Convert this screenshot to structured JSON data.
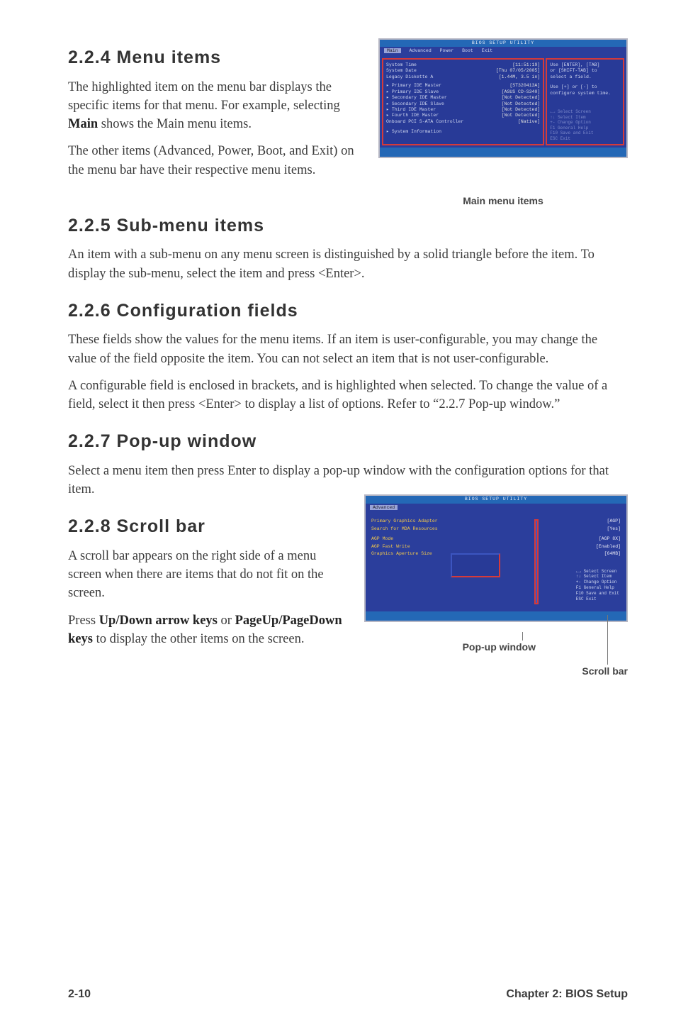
{
  "s224": {
    "heading": "2.2.4  Menu items",
    "p1a": "The highlighted item on the menu bar displays the specific items for that menu. For example, selecting ",
    "main": "Main",
    "p1b": " shows the Main menu items.",
    "p2": "The other items (Advanced, Power, Boot, and Exit) on the menu bar have their respective menu items."
  },
  "main_caption": "Main menu items",
  "bios": {
    "title": "BIOS SETUP UTILITY",
    "menubar": [
      "Main",
      "Advanced",
      "Power",
      "Boot",
      "Exit"
    ],
    "system_time_k": "System Time",
    "system_time_v": "[11:51:19]",
    "system_date_k": "System Date",
    "system_date_v": "[Thu 07/05/2005]",
    "legacy_k": "Legacy Diskette A",
    "legacy_v": "[1.44M, 3.5 in]",
    "rows": [
      {
        "k": "▸ Primary IDE Master",
        "v": "[ST320413A]"
      },
      {
        "k": "▸ Primary IDE Slave",
        "v": "[ASUS CD-S340]"
      },
      {
        "k": "▸ Secondary IDE Master",
        "v": "[Not Detected]"
      },
      {
        "k": "▸ Secondary IDE Slave",
        "v": "[Not Detected]"
      },
      {
        "k": "▸ Third IDE Master",
        "v": "[Not Detected]"
      },
      {
        "k": "▸ Fourth IDE Master",
        "v": "[Not Detected]"
      },
      {
        "k": "Onboard PCI S-ATA Controller",
        "v": "[Native]"
      }
    ],
    "sysinfo": "▸ System Information",
    "help1": "Use [ENTER], [TAB]\nor [SHIFT-TAB] to\nselect a field.",
    "help2": "Use [+] or [-] to\nconfigure system time.",
    "legend": "←→  Select Screen\n↑↓  Select Item\n+-  Change Option\nF1  General Help\nF10 Save and Exit\nESC Exit"
  },
  "s225": {
    "heading": "2.2.5  Sub-menu items",
    "p": "An item with a sub-menu on any menu screen is distinguished by a solid triangle before the item. To display the sub-menu, select the item and press <Enter>."
  },
  "s226": {
    "heading": "2.2.6  Configuration fields",
    "p1": "These fields show the values for the menu items. If an item is user-configurable, you may change the value of the field opposite the item. You can not select an item that is not user-configurable.",
    "p2": "A configurable field is enclosed in brackets, and is highlighted when selected. To change the value of a field, select it then press <Enter> to display a list of options. Refer to “2.2.7 Pop-up window.”"
  },
  "s227": {
    "heading": "2.2.7  Pop-up window",
    "p": "Select a menu item then press Enter to display a pop-up window with the configuration options for that item."
  },
  "s228": {
    "heading": "2.2.8  Scroll bar",
    "p1": "A scroll bar appears on the right side of a menu screen when there are items that do not fit on the screen.",
    "p2a": "Press ",
    "k1": "Up/Down arrow keys",
    "p2b": " or ",
    "k2": "PageUp/PageDown keys",
    "p2c": " to display the other items on the screen."
  },
  "pop_ss": {
    "title": "BIOS SETUP UTILITY",
    "tab": "Advanced",
    "fields": [
      {
        "k": "Primary Graphics Adapter",
        "v": "[AGP]"
      },
      {
        "k": "Search for MDA Resources",
        "v": "[Yes]"
      },
      {
        "k": "AGP Mode",
        "v": "[AGP 8X]"
      },
      {
        "k": "AGP Fast Write",
        "v": "[Enabled]"
      },
      {
        "k": "Graphics Aperture Size",
        "v": "[64MB]"
      }
    ],
    "help": "←→  Select Screen\n↑↓  Select Item\n+-  Change Option\nF1  General Help\nF10 Save and Exit\nESC Exit"
  },
  "popup_label": "Pop-up window",
  "scroll_label": "Scroll bar",
  "footer_left": "2-10",
  "footer_right": "Chapter 2: BIOS Setup"
}
